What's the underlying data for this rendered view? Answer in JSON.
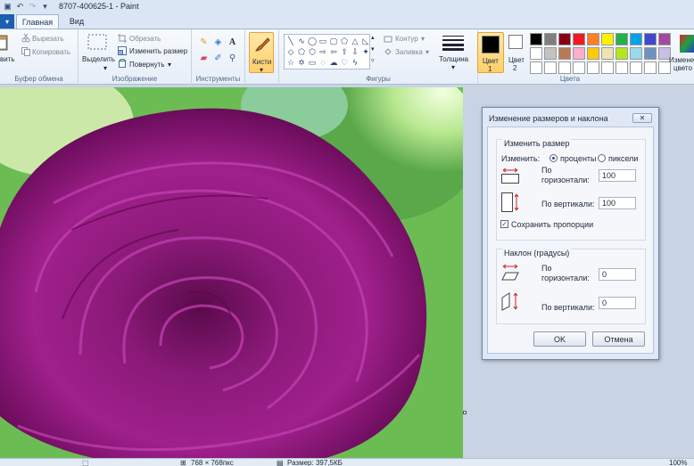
{
  "window": {
    "title": "8707-400625-1 - Paint"
  },
  "tabs": {
    "file": "",
    "home": "Главная",
    "view": "Вид"
  },
  "clipboard": {
    "paste": "вить",
    "cut": "Вырезать",
    "copy": "Копировать",
    "label": "Буфер обмена"
  },
  "image": {
    "select": "Выделить",
    "crop": "Обрезать",
    "resize": "Изменить размер",
    "rotate": "Повернуть",
    "label": "Изображение"
  },
  "tools": {
    "label": "Инструменты"
  },
  "brushes": {
    "label": "Кисти"
  },
  "shapes": {
    "outline": "Контур",
    "fill": "Заливка",
    "label": "Фигуры"
  },
  "size": {
    "label": "Толщина"
  },
  "color1": {
    "label_line1": "Цвет",
    "label_line2": "1"
  },
  "color2": {
    "label_line1": "Цвет",
    "label_line2": "2"
  },
  "colors": {
    "label": "Цвета",
    "edit_line1": "Измене",
    "edit_line2": "цвето",
    "palette_row1": [
      "#000000",
      "#7f7f7f",
      "#880015",
      "#ed1c24",
      "#ff7f27",
      "#fff200",
      "#22b14c",
      "#00a2e8",
      "#3f48cc",
      "#a349a4"
    ],
    "palette_row2": [
      "#ffffff",
      "#c3c3c3",
      "#b97a57",
      "#ffaec9",
      "#ffc90e",
      "#efe4b0",
      "#b5e61d",
      "#99d9ea",
      "#7092be",
      "#c8bfe7"
    ],
    "palette_row3": [
      "#ffffff",
      "#ffffff",
      "#ffffff",
      "#ffffff",
      "#ffffff",
      "#ffffff",
      "#ffffff",
      "#ffffff",
      "#ffffff",
      "#ffffff"
    ]
  },
  "dialog": {
    "title": "Изменение размеров и наклона",
    "resize_section": "Изменить размер",
    "by_label": "Изменить:",
    "percent": "проценты",
    "pixels": "пиксели",
    "horiz_line1": "По",
    "horiz_line2": "горизонтали:",
    "horiz_value": "100",
    "vert_label": "По вертикали:",
    "vert_value": "100",
    "keep_ratio": "Сохранить пропорции",
    "skew_section": "Наклон (градусы)",
    "skew_horiz_line1": "По",
    "skew_horiz_line2": "горизонтали:",
    "skew_horiz_value": "0",
    "skew_vert_label": "По вертикали:",
    "skew_vert_value": "0",
    "ok": "OK",
    "cancel": "Отмена"
  },
  "status": {
    "dimensions": "768 × 768пкс",
    "filesize": "Размер: 397,5КБ",
    "zoom": "100%"
  }
}
